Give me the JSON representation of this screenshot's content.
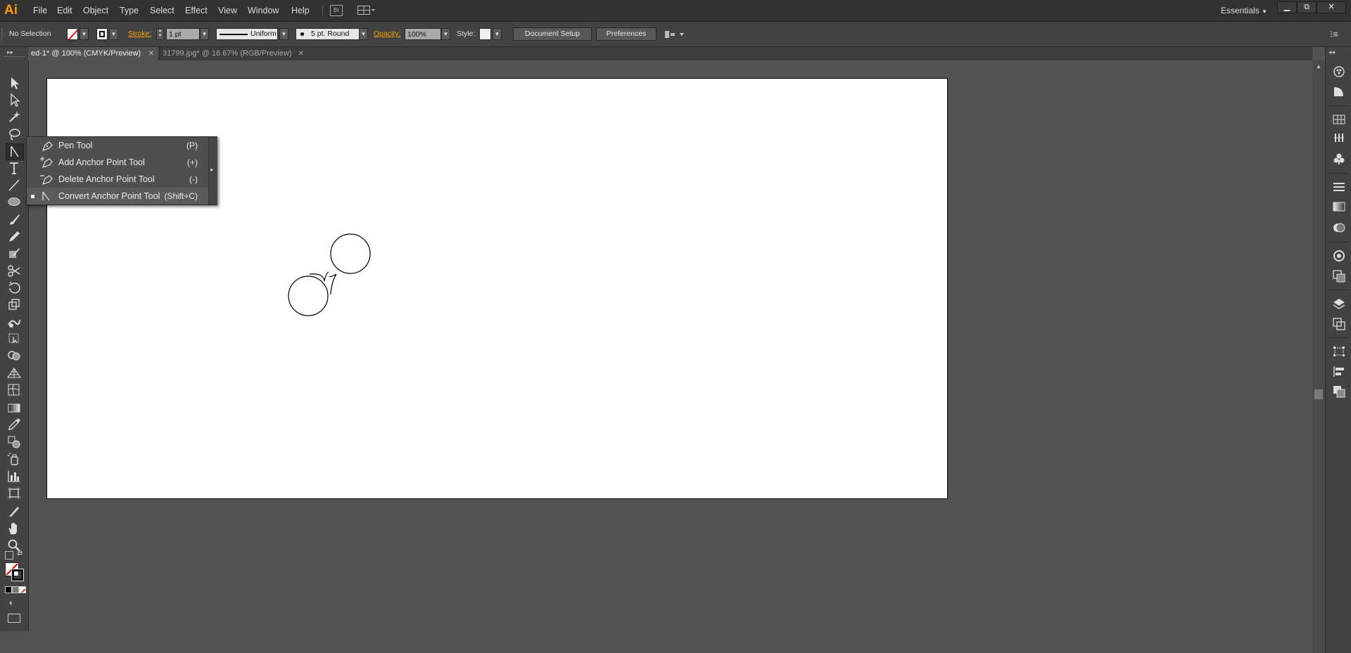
{
  "app": {
    "logo": "Ai"
  },
  "menu": [
    "File",
    "Edit",
    "Object",
    "Type",
    "Select",
    "Effect",
    "View",
    "Window",
    "Help"
  ],
  "workspace": {
    "label": "Essentials"
  },
  "window_controls": {
    "minimize": "▁",
    "restore": "⧉",
    "close": "✕"
  },
  "control_bar": {
    "selection": "No Selection",
    "stroke_label": "Stroke:",
    "stroke_weight": "1 pt",
    "profile": "Uniform",
    "brush": "5 pt. Round",
    "opacity_label": "Opacity:",
    "opacity": "100%",
    "style_label": "Style:",
    "document_setup": "Document Setup",
    "preferences": "Preferences"
  },
  "tabs": [
    {
      "label": "ed-1* @ 100% (CMYK/Preview)",
      "active": true
    },
    {
      "label": "31799.jpg* @ 16.67% (RGB/Preview)",
      "active": false
    }
  ],
  "tab_close": "✕",
  "flyout": {
    "items": [
      {
        "label": "Pen Tool",
        "shortcut": "(P)",
        "icon": "pen-icon",
        "selected": false
      },
      {
        "label": "Add Anchor Point Tool",
        "shortcut": "(+)",
        "icon": "add-anchor-point-icon",
        "selected": false
      },
      {
        "label": "Delete Anchor Point Tool",
        "shortcut": "(-)",
        "icon": "delete-anchor-point-icon",
        "selected": false
      },
      {
        "label": "Convert Anchor Point Tool",
        "shortcut": "(Shift+C)",
        "icon": "convert-anchor-point-icon",
        "selected": true
      }
    ]
  },
  "tools": [
    "selection-icon",
    "direct-selection-icon",
    "magic-wand-icon",
    "lasso-icon",
    "convert-anchor-point-icon",
    "type-icon",
    "line-segment-icon",
    "ellipse-icon",
    "paintbrush-icon",
    "pencil-icon",
    "blob-brush-icon",
    "scissors-icon",
    "rotate-icon",
    "scale-icon",
    "warp-icon",
    "free-transform-icon",
    "shape-builder-icon",
    "perspective-grid-icon",
    "mesh-icon",
    "gradient-icon",
    "eyedropper-icon",
    "blend-icon",
    "symbol-sprayer-icon",
    "column-graph-icon",
    "artboard-icon",
    "slice-icon",
    "hand-icon",
    "zoom-icon"
  ],
  "dock": [
    "color-icon",
    "color-guide-icon",
    "swatches-icon",
    "brushes-icon",
    "symbols-icon",
    "stroke-icon",
    "gradient-panel-icon",
    "transparency-icon",
    "appearance-icon",
    "graphic-styles-icon",
    "layers-icon",
    "artboards-panel-icon",
    "transform-icon",
    "align-icon",
    "pathfinder-icon"
  ],
  "colors": {
    "accent": "#ff9a00",
    "canvas": "#535353",
    "artboard": "#ffffff"
  }
}
